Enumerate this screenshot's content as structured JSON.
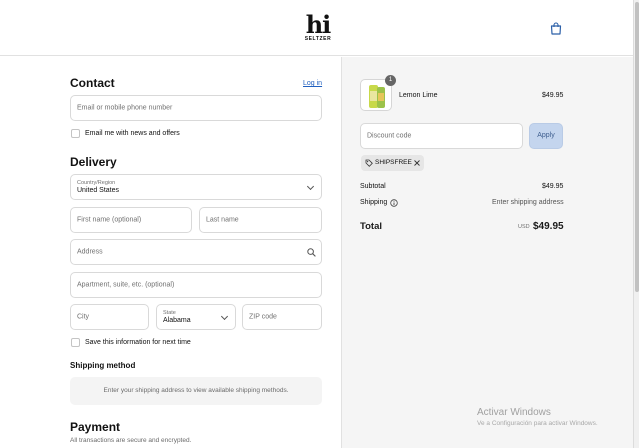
{
  "header": {
    "logo_text": "hi",
    "logo_subtext": "SELTZER"
  },
  "contact": {
    "title": "Contact",
    "login_link": "Log in",
    "email_placeholder": "Email or mobile phone number",
    "news_checkbox_label": "Email me with news and offers"
  },
  "delivery": {
    "title": "Delivery",
    "country_label": "Country/Region",
    "country_value": "United States",
    "first_name_placeholder": "First name (optional)",
    "last_name_placeholder": "Last name",
    "address_placeholder": "Address",
    "apartment_placeholder": "Apartment, suite, etc. (optional)",
    "city_placeholder": "City",
    "state_label": "State",
    "state_value": "Alabama",
    "zip_placeholder": "ZIP code",
    "save_info_label": "Save this information for next time"
  },
  "shipping_method": {
    "title": "Shipping method",
    "notice": "Enter your shipping address to view available shipping methods."
  },
  "payment": {
    "title": "Payment",
    "subtitle": "All transactions are secure and encrypted."
  },
  "summary": {
    "product_name": "Lemon Lime",
    "product_quantity": "1",
    "product_price": "$49.95",
    "discount_placeholder": "Discount code",
    "apply_label": "Apply",
    "discount_chip": "SHIPSFREE",
    "subtotal_label": "Subtotal",
    "subtotal_value": "$49.95",
    "shipping_label": "Shipping",
    "shipping_value": "Enter shipping address",
    "total_label": "Total",
    "total_currency": "USD",
    "total_value": "$49.95"
  },
  "watermark": {
    "title": "Activar Windows",
    "subtitle": "Ve a Configuración para activar Windows."
  },
  "colors": {
    "link": "#1f5fbf",
    "apply_button": "#c4d5ee",
    "summary_bg": "#f5f5f5"
  },
  "icons": [
    "shopping-bag-icon",
    "search-icon",
    "info-icon",
    "tag-icon",
    "close-icon",
    "chevron-down-icon"
  ]
}
